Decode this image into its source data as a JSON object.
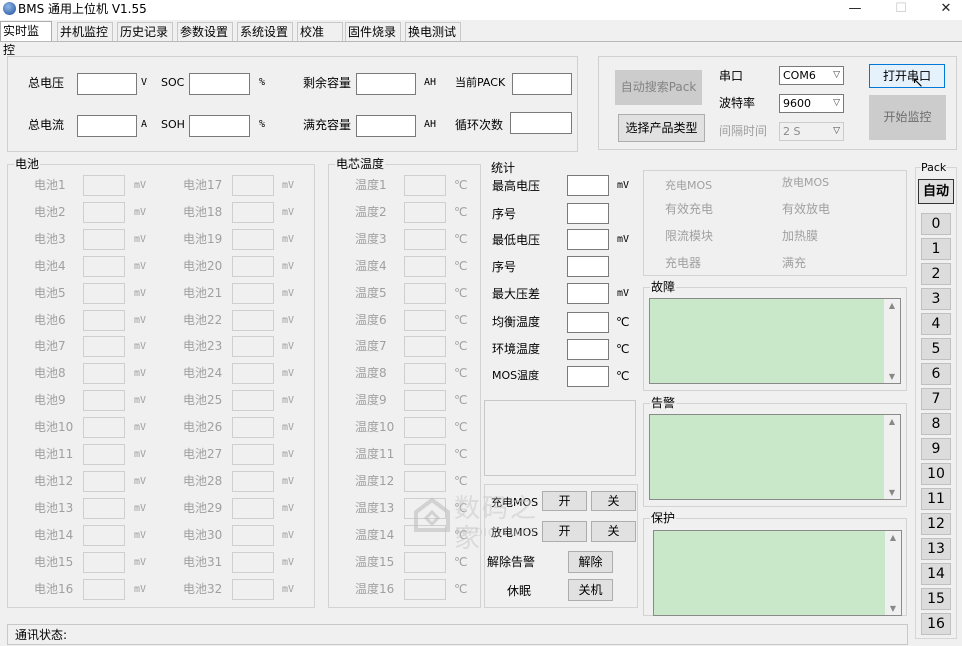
{
  "window": {
    "title": "BMS 通用上位机 V1.55",
    "minimize": "—",
    "maximize": "☐",
    "close": "✕"
  },
  "tabs": [
    "实时监控",
    "并机监控",
    "历史记录",
    "参数设置",
    "系统设置",
    "校准",
    "固件烧录",
    "换电测试"
  ],
  "summary": {
    "total_voltage": "总电压",
    "total_voltage_unit": "V",
    "soc": "SOC",
    "soc_unit": "%",
    "remaining_capacity": "剩余容量",
    "remaining_capacity_unit": "AH",
    "current_pack": "当前PACK",
    "total_current": "总电流",
    "total_current_unit": "A",
    "soh": "SOH",
    "soh_unit": "%",
    "full_capacity": "满充容量",
    "full_capacity_unit": "AH",
    "cycles": "循环次数"
  },
  "serial": {
    "auto_search": "自动搜索Pack",
    "select_product": "选择产品类型",
    "port_label": "串口",
    "port_value": "COM6",
    "baud_label": "波特率",
    "baud_value": "9600",
    "interval_label": "间隔时间",
    "interval_value": "2 S",
    "open_port": "打开串口",
    "start_monitor": "开始监控"
  },
  "cells": {
    "title": "电池",
    "unit": "mV",
    "left": [
      "电池1",
      "电池2",
      "电池3",
      "电池4",
      "电池5",
      "电池6",
      "电池7",
      "电池8",
      "电池9",
      "电池10",
      "电池11",
      "电池12",
      "电池13",
      "电池14",
      "电池15",
      "电池16"
    ],
    "right": [
      "电池17",
      "电池18",
      "电池19",
      "电池20",
      "电池21",
      "电池22",
      "电池23",
      "电池24",
      "电池25",
      "电池26",
      "电池27",
      "电池28",
      "电池29",
      "电池30",
      "电池31",
      "电池32"
    ]
  },
  "temps": {
    "title": "电芯温度",
    "unit": "℃",
    "items": [
      "温度1",
      "温度2",
      "温度3",
      "温度4",
      "温度5",
      "温度6",
      "温度7",
      "温度8",
      "温度9",
      "温度10",
      "温度11",
      "温度12",
      "温度13",
      "温度14",
      "温度15",
      "温度16"
    ]
  },
  "stats": {
    "title": "统计",
    "max_v": "最高电压",
    "max_v_unit": "mV",
    "max_v_idx": "序号",
    "min_v": "最低电压",
    "min_v_unit": "mV",
    "min_v_idx": "序号",
    "max_diff": "最大压差",
    "max_diff_unit": "mV",
    "balance_temp": "均衡温度",
    "balance_temp_unit": "℃",
    "env_temp": "环境温度",
    "env_temp_unit": "℃",
    "mos_temp": "MOS温度",
    "mos_temp_unit": "℃"
  },
  "controls": {
    "charge_mos": "充电MOS",
    "discharge_mos": "放电MOS",
    "on": "开",
    "off": "关",
    "clear_alarm": "解除告警",
    "clear": "解除",
    "sleep": "休眠",
    "shutdown": "关机"
  },
  "status_flags": {
    "charge_mos": "充电MOS",
    "discharge_mos": "放电MOS",
    "effective_charge": "有效充电",
    "effective_discharge": "有效放电",
    "current_limit": "限流模块",
    "heating_film": "加热膜",
    "charger": "充电器",
    "full": "满充"
  },
  "fault": {
    "title": "故障"
  },
  "warning": {
    "title": "告警"
  },
  "protection": {
    "title": "保护"
  },
  "pack": {
    "title": "Pack",
    "auto": "自动",
    "numbers": [
      "0",
      "1",
      "2",
      "3",
      "4",
      "5",
      "6",
      "7",
      "8",
      "9",
      "10",
      "11",
      "12",
      "13",
      "14",
      "15",
      "16"
    ]
  },
  "statusbar": {
    "label": "通讯状态:"
  },
  "watermark": {
    "text": "数码之家",
    "sub": "MYDIGIT.NET"
  }
}
